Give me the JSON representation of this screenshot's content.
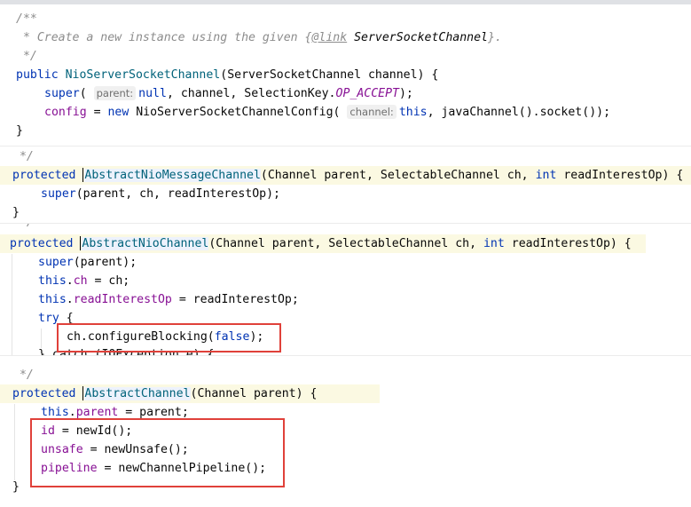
{
  "colors": {
    "keyword": "#0033b3",
    "method": "#00627a",
    "field": "#871094",
    "comment": "#8c8c8c",
    "highlight_box": "#e0413a"
  },
  "snippet1": {
    "doc_open": "/**",
    "doc_star": " * Create a new instance using the given {",
    "doc_tag": "@link",
    "doc_ref": " ServerSocketChannel",
    "doc_end": "}.",
    "doc_close": " */",
    "sig_kw": "public ",
    "sig_name": "NioServerSocketChannel",
    "sig_rest": "(ServerSocketChannel channel) {",
    "super_kw": "super",
    "super_open": "( ",
    "super_hint": "parent:",
    "super_null": "null",
    "super_mid": ", channel, SelectionKey.",
    "super_const": "OP_ACCEPT",
    "super_end": ");",
    "config_field": "config",
    "config_eq": " = ",
    "config_new": "new ",
    "config_class": "NioServerSocketChannelConfig( ",
    "config_hint": "channel:",
    "config_this": "this",
    "config_rest": ", javaChannel().socket());",
    "close": "}"
  },
  "snippet2": {
    "comment_end": " */",
    "sig_kw": "protected ",
    "sig_name": "AbstractNioMessageChannel",
    "sig_rest": "(Channel parent, SelectableChannel ch, ",
    "sig_int": "int",
    "sig_tail": " readInterestOp) {",
    "super_kw": "super",
    "super_rest": "(parent, ch, readInterestOp);",
    "close": "}"
  },
  "snippet3": {
    "comment_end": " */",
    "sig_kw": "protected ",
    "sig_name": "AbstractNioChannel",
    "sig_rest": "(Channel parent, SelectableChannel ch, ",
    "sig_int": "int",
    "sig_tail": " readInterestOp) {",
    "super_kw": "super",
    "super_rest": "(parent);",
    "this1_kw": "this",
    "this1_dot": ".",
    "this1_field": "ch",
    "this1_rest": " = ch;",
    "this2_kw": "this",
    "this2_dot": ".",
    "this2_field": "readInterestOp",
    "this2_rest": " = readInterestOp;",
    "try_kw": "try",
    "try_rest": " {",
    "blocking_pre": "ch.configureBlocking(",
    "blocking_false": "false",
    "blocking_end": ");",
    "catch_partial": "} catch (IOException e) {"
  },
  "snippet4": {
    "comment_end": " */",
    "sig_kw": "protected ",
    "sig_name": "AbstractChannel",
    "sig_rest": "(Channel parent) {",
    "this_kw": "this",
    "this_dot": ".",
    "this_field": "parent",
    "this_rest": " = parent;",
    "id_field": "id",
    "id_rest": " = newId();",
    "unsafe_field": "unsafe",
    "unsafe_rest": " = newUnsafe();",
    "pipeline_field": "pipeline",
    "pipeline_rest": " = newChannelPipeline();",
    "close": "}"
  }
}
